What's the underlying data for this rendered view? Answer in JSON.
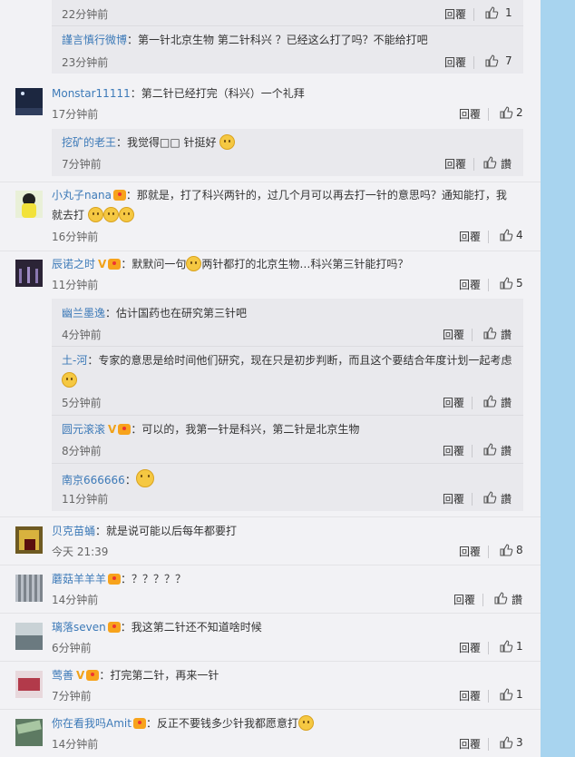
{
  "reply_label": "回覆",
  "like_label": "讚",
  "comments": [
    {
      "time": "22分钟前",
      "likes": "1"
    },
    {
      "name": "謹言慎行微博",
      "text": "：第一针北京生物 第二针科兴 ？已经这么打了吗？不能给打吧",
      "time": "23分钟前",
      "likes": "7"
    },
    {
      "name": "Monstar11111",
      "text": "：第二针已经打完（科兴）一个礼拜",
      "time": "17分钟前",
      "likes": "2"
    },
    {
      "name": "挖矿的老王",
      "text": "：我觉得□□ 针挺好",
      "time": "7分钟前"
    },
    {
      "name": "小丸子nana",
      "text": "：那就是，打了科兴两针的，过几个月可以再去打一针的意思吗？通知能打，我就去打",
      "time": "16分钟前",
      "likes": "4"
    },
    {
      "name": "辰诺之时",
      "text_a": "：默默问一句",
      "text_b": "两针都打的北京生物…科兴第三针能打吗？",
      "time": "11分钟前",
      "likes": "5"
    },
    {
      "name": "幽兰墨逸",
      "text": "：估计国药也在研究第三针吧",
      "time": "4分钟前"
    },
    {
      "name": "土-河",
      "text": "：专家的意思是给时间他们研究，现在只是初步判断，而且这个要结合年度计划一起考虑",
      "time": "5分钟前"
    },
    {
      "name": "圆元滚滚",
      "text": "：可以的，我第一针是科兴，第二针是北京生物",
      "time": "8分钟前"
    },
    {
      "name": "南京666666",
      "text": "：",
      "time": "11分钟前"
    },
    {
      "name": "贝克苗蛹",
      "text": "：就是说可能以后每年都要打",
      "time": "今天 21:39",
      "likes": "8"
    },
    {
      "name": "蘑菇羊羊羊",
      "text": "：？？？？？",
      "time": "14分钟前"
    },
    {
      "name": "璃落seven",
      "text": "：我这第二针还不知道啥时候",
      "time": "6分钟前",
      "likes": "1"
    },
    {
      "name": "莺善",
      "text": "：打完第二针，再来一针",
      "time": "7分钟前",
      "likes": "1"
    },
    {
      "name": "你在看我吗Amit",
      "text": "：反正不要钱多少针我都愿意打",
      "time": "14分钟前",
      "likes": "3"
    }
  ],
  "colors": {
    "link": "#3d7ab8",
    "sidebar": "#a8d4ef",
    "page": "#f2f2f5",
    "subpanel": "#e9e9ed"
  }
}
